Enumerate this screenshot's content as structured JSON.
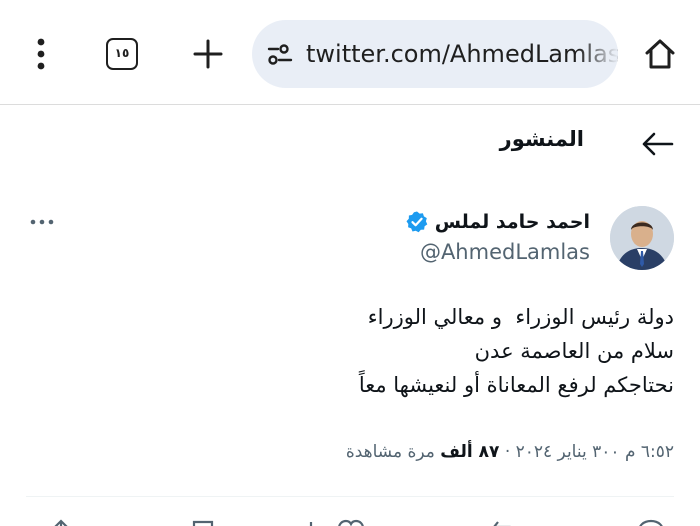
{
  "browser": {
    "url": "twitter.com/AhmedLamlas",
    "tab_count": "١٥",
    "icons": {
      "home": "home-icon",
      "site_settings": "tune-icon",
      "new_tab": "plus-icon",
      "tabs": "tab-switcher-icon",
      "menu": "kebab-menu-icon"
    }
  },
  "post_header": {
    "title": "المنشور",
    "back_icon": "arrow-left-icon"
  },
  "author": {
    "name": "احمد حامد لملس",
    "handle": "@AhmedLamlas",
    "verified": true,
    "verified_color": "#1d9bf0"
  },
  "tweet": {
    "lines": [
      "دولة رئيس الوزراء  و معالي الوزراء",
      "سلام من العاصمة عدن   ",
      "نحتاجكم لرفع المعاناة أو لنعيشها معاً"
    ]
  },
  "meta": {
    "time": "٦:٥٢ م",
    "date": "٣٠٠ يناير ٢٠٢٤",
    "views_count": "٨٧ ألف",
    "views_label": "مرة مشاهدة",
    "separator": "·"
  },
  "actions": [
    "reply-icon",
    "retweet-icon",
    "like-icon",
    "views-icon",
    "bookmark-icon",
    "share-icon"
  ],
  "colors": {
    "text_primary": "#0f1419",
    "text_secondary": "#536471",
    "url_bar_bg": "#e9eef6",
    "accent": "#1d9bf0"
  }
}
